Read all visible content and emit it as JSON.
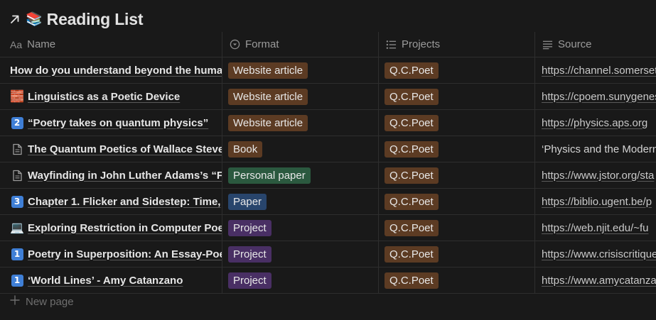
{
  "page": {
    "title": "Reading List",
    "title_icon": "books-icon",
    "link_icon": "arrow-up-right-icon"
  },
  "columns": {
    "name": {
      "label": "Name",
      "icon": "Aa"
    },
    "format": {
      "label": "Format",
      "icon": "select-icon"
    },
    "projects": {
      "label": "Projects",
      "icon": "list-icon"
    },
    "source": {
      "label": "Source",
      "icon": "text-lines-icon"
    }
  },
  "rows": [
    {
      "icon": "none",
      "name": "How do you understand beyond the human",
      "format": "Website article",
      "format_color": "brown",
      "project": "Q.C.Poet",
      "source": "https://channel.somerset"
    },
    {
      "icon": "brick-emoji",
      "icon_glyph": "🧱",
      "name": "Linguistics as a Poetic Device",
      "format": "Website article",
      "format_color": "brown",
      "project": "Q.C.Poet",
      "source": "https://cpoem.sunygenesee"
    },
    {
      "icon": "keycap-2",
      "icon_glyph": "2",
      "name": "“Poetry takes on quantum physics”",
      "format": "Website article",
      "format_color": "brown",
      "project": "Q.C.Poet",
      "source": "https://physics.aps.org"
    },
    {
      "icon": "page-icon",
      "name": "The Quantum Poetics of Wallace Stevens",
      "format": "Book",
      "format_color": "brown",
      "project": "Q.C.Poet",
      "source": "‘Physics and the Modern"
    },
    {
      "icon": "page-icon",
      "name": "Wayfinding in John Luther Adams’s “Fi",
      "format": "Personal paper",
      "format_color": "green",
      "project": "Q.C.Poet",
      "source": "https://www.jstor.org/sta"
    },
    {
      "icon": "keycap-3",
      "icon_glyph": "3",
      "name": "Chapter 1. Flicker and Sidestep: Time,",
      "format": "Paper",
      "format_color": "blue",
      "project": "Q.C.Poet",
      "source": "https://biblio.ugent.be/p"
    },
    {
      "icon": "laptop-emoji",
      "icon_glyph": "💻",
      "name": "Exploring Restriction in Computer Poetry",
      "format": "Project",
      "format_color": "purple",
      "project": "Q.C.Poet",
      "source": "https://web.njit.edu/~fu"
    },
    {
      "icon": "keycap-1",
      "icon_glyph": "1",
      "name": "Poetry in Superposition: An Essay-Poem",
      "format": "Project",
      "format_color": "purple",
      "project": "Q.C.Poet",
      "source": "https://www.crisiscritique"
    },
    {
      "icon": "keycap-1",
      "icon_glyph": "1",
      "name": "‘World Lines’ - Amy Catanzano",
      "format": "Project",
      "format_color": "purple",
      "project": "Q.C.Poet",
      "source": "https://www.amycatanzano"
    }
  ],
  "footer": {
    "new_page_label": "New page",
    "icon": "plus-icon"
  },
  "colors": {
    "background": "#191919",
    "tag_brown": "#5c3b23",
    "tag_green": "#2b593f",
    "tag_blue": "#28456c",
    "tag_purple": "#492f64",
    "keycap_blue": "#3f7fd6"
  }
}
